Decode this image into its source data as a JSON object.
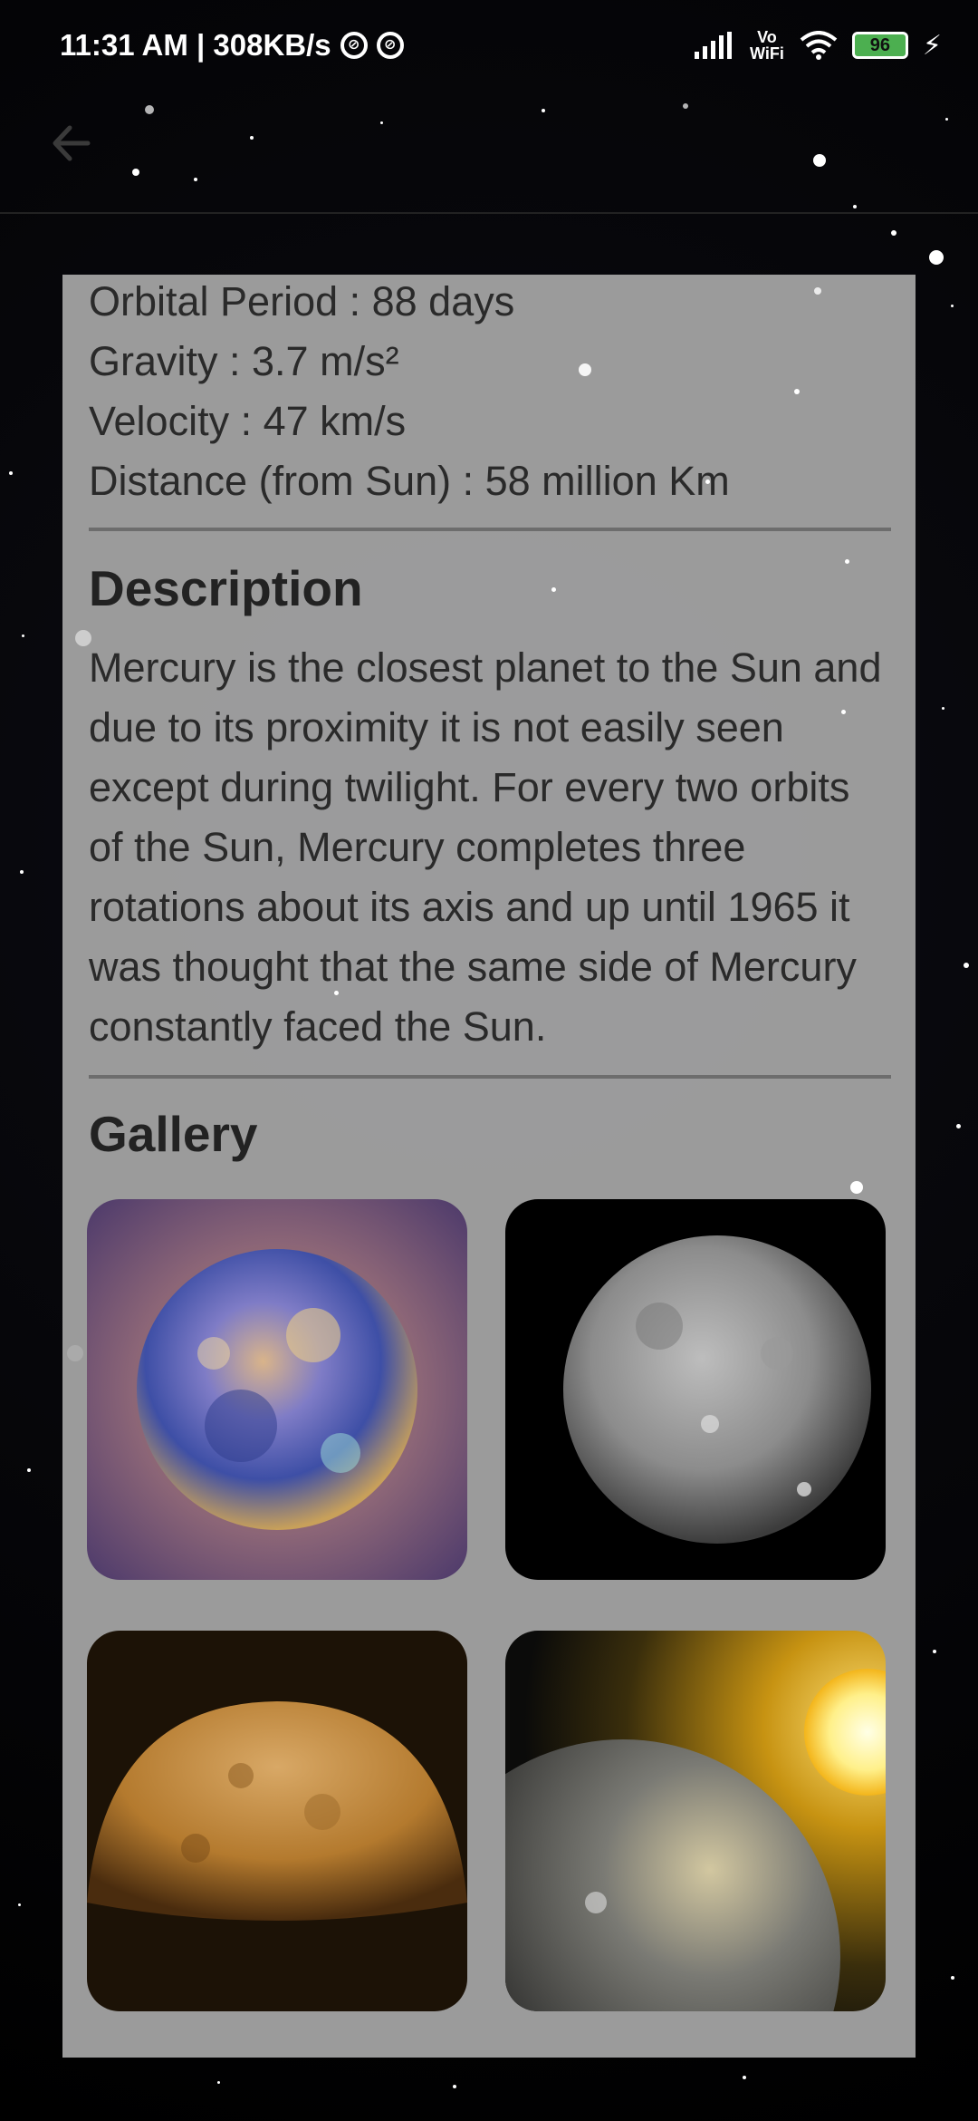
{
  "status_bar": {
    "time_speed": "11:31 AM | 308KB/s",
    "network_label": "Vo WiFi",
    "battery": "96"
  },
  "planet": {
    "stats": [
      "Orbital Period : 88 days",
      "Gravity : 3.7 m/s²",
      "Velocity : 47 km/s",
      "Distance (from Sun) : 58 million Km"
    ],
    "description_title": "Description",
    "description": "Mercury is the closest planet to the Sun and due to its proximity it is not easily seen except during twilight. For every two orbits of the Sun, Mercury completes three rotations about its axis and up until 1965 it was thought that the same side of Mercury constantly faced the Sun.",
    "gallery_title": "Gallery"
  },
  "gallery": {
    "images": [
      {
        "icon": "mercury-color-enhanced-image"
      },
      {
        "icon": "mercury-grayscale-image"
      },
      {
        "icon": "mercury-golden-surface-image"
      },
      {
        "icon": "mercury-with-sun-image"
      }
    ]
  },
  "colors": {
    "card_bg": "#a5a5a5",
    "divider": "#6d6d6d",
    "text": "#2a2a2a",
    "battery": "#4caf50"
  }
}
